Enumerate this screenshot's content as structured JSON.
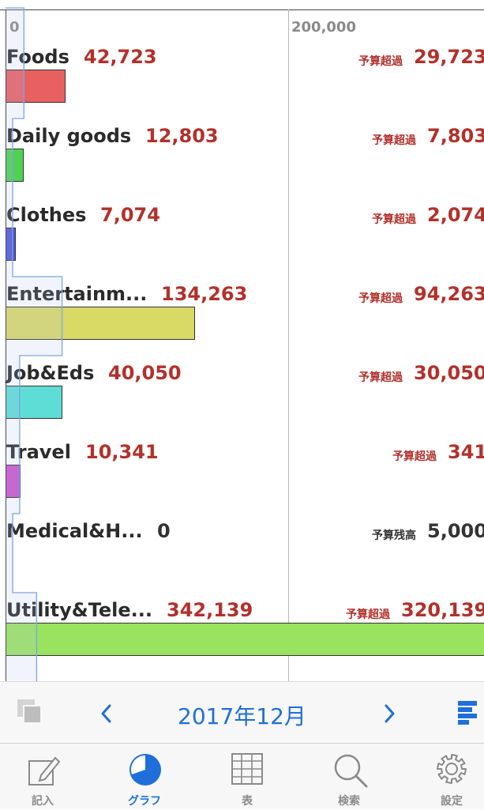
{
  "axis": {
    "zero_label": "0",
    "max_label": "200,000"
  },
  "categories": [
    {
      "name": "Foods",
      "amount": "42,723",
      "status": "予算超過",
      "diff": "29,723",
      "over": true,
      "value": 42723,
      "color": "#e86060"
    },
    {
      "name": "Daily goods",
      "amount": "12,803",
      "status": "予算超過",
      "diff": "7,803",
      "over": true,
      "value": 12803,
      "color": "#4fd24f"
    },
    {
      "name": "Clothes",
      "amount": "7,074",
      "status": "予算超過",
      "diff": "2,074",
      "over": true,
      "value": 7074,
      "color": "#5056d6"
    },
    {
      "name": "Entertainm...",
      "amount": "134,263",
      "status": "予算超過",
      "diff": "94,263",
      "over": true,
      "value": 134263,
      "color": "#d9d966"
    },
    {
      "name": "Job&Eds",
      "amount": "40,050",
      "status": "予算超過",
      "diff": "30,050",
      "over": true,
      "value": 40050,
      "color": "#5edcd6"
    },
    {
      "name": "Travel",
      "amount": "10,341",
      "status": "予算超過",
      "diff": "341",
      "over": true,
      "value": 10341,
      "color": "#cc55cc"
    },
    {
      "name": "Medical&H...",
      "amount": "0",
      "status": "予算残高",
      "diff": "5,000",
      "over": false,
      "value": 0,
      "color": "#cccccc"
    },
    {
      "name": "Utility&Tele...",
      "amount": "342,139",
      "status": "予算超過",
      "diff": "320,139",
      "over": true,
      "value": 342139,
      "color": "#9ae35f"
    }
  ],
  "budgets": [
    13000,
    5000,
    5000,
    40000,
    10000,
    10000,
    5000,
    22000
  ],
  "colors": {
    "over": "#b3302b",
    "normal": "#333333",
    "accent": "#1e6fd9",
    "budget_line": "#7aa6e0"
  },
  "toolbar": {
    "month": "2017年12月",
    "prev_icon": "chevron-left-icon",
    "next_icon": "chevron-right-icon",
    "left_icon": "layers-icon",
    "right_icon": "bar-list-icon"
  },
  "tabs": [
    {
      "label": "記入",
      "icon": "edit-icon",
      "active": false
    },
    {
      "label": "グラフ",
      "icon": "pie-chart-icon",
      "active": true
    },
    {
      "label": "表",
      "icon": "grid-icon",
      "active": false
    },
    {
      "label": "検索",
      "icon": "search-icon",
      "active": false
    },
    {
      "label": "設定",
      "icon": "gear-icon",
      "active": false
    }
  ]
}
